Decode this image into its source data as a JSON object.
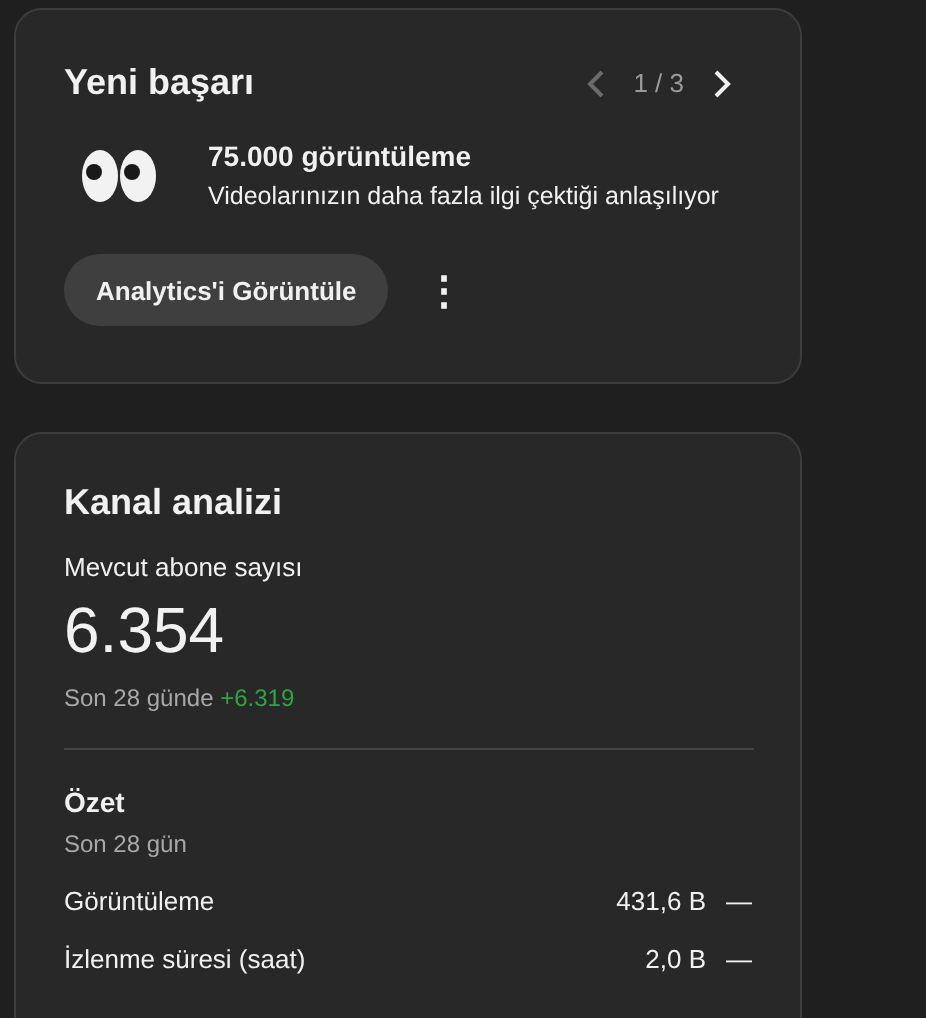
{
  "achievement_card": {
    "title": "Yeni başarı",
    "pager": {
      "prev_disabled": true,
      "next_disabled": false,
      "position": "1 / 3"
    },
    "milestone": {
      "title": "75.000 görüntüleme",
      "description": "Videolarınızın daha fazla ilgi çektiği anlaşılıyor"
    },
    "button": "Analytics'i Görüntüle",
    "more_menu": "⋮"
  },
  "channel_card": {
    "title": "Kanal analizi",
    "subscribers_label": "Mevcut abone sayısı",
    "subscribers": "6.354",
    "change_prefix": "Son 28 günde",
    "change": "+6.319",
    "summary": {
      "title": "Özet",
      "period": "Son 28 gün",
      "rows": [
        {
          "label": "Görüntüleme",
          "value": "431,6 B",
          "trend": "—"
        },
        {
          "label": "İzlenme süresi (saat)",
          "value": "2,0 B",
          "trend": "—"
        }
      ]
    }
  }
}
